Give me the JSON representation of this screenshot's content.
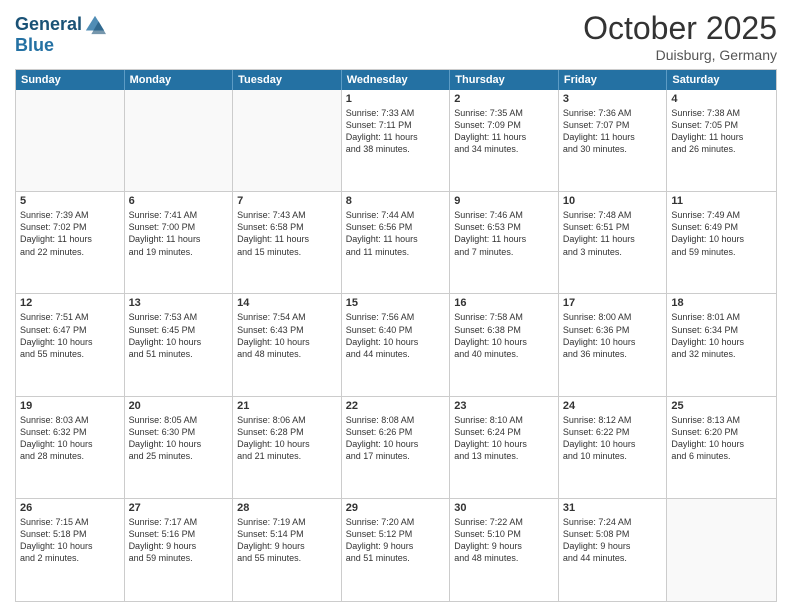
{
  "header": {
    "logo_line1": "General",
    "logo_line2": "Blue",
    "month": "October 2025",
    "location": "Duisburg, Germany"
  },
  "days_of_week": [
    "Sunday",
    "Monday",
    "Tuesday",
    "Wednesday",
    "Thursday",
    "Friday",
    "Saturday"
  ],
  "weeks": [
    [
      {
        "day": "",
        "info": ""
      },
      {
        "day": "",
        "info": ""
      },
      {
        "day": "",
        "info": ""
      },
      {
        "day": "1",
        "info": "Sunrise: 7:33 AM\nSunset: 7:11 PM\nDaylight: 11 hours\nand 38 minutes."
      },
      {
        "day": "2",
        "info": "Sunrise: 7:35 AM\nSunset: 7:09 PM\nDaylight: 11 hours\nand 34 minutes."
      },
      {
        "day": "3",
        "info": "Sunrise: 7:36 AM\nSunset: 7:07 PM\nDaylight: 11 hours\nand 30 minutes."
      },
      {
        "day": "4",
        "info": "Sunrise: 7:38 AM\nSunset: 7:05 PM\nDaylight: 11 hours\nand 26 minutes."
      }
    ],
    [
      {
        "day": "5",
        "info": "Sunrise: 7:39 AM\nSunset: 7:02 PM\nDaylight: 11 hours\nand 22 minutes."
      },
      {
        "day": "6",
        "info": "Sunrise: 7:41 AM\nSunset: 7:00 PM\nDaylight: 11 hours\nand 19 minutes."
      },
      {
        "day": "7",
        "info": "Sunrise: 7:43 AM\nSunset: 6:58 PM\nDaylight: 11 hours\nand 15 minutes."
      },
      {
        "day": "8",
        "info": "Sunrise: 7:44 AM\nSunset: 6:56 PM\nDaylight: 11 hours\nand 11 minutes."
      },
      {
        "day": "9",
        "info": "Sunrise: 7:46 AM\nSunset: 6:53 PM\nDaylight: 11 hours\nand 7 minutes."
      },
      {
        "day": "10",
        "info": "Sunrise: 7:48 AM\nSunset: 6:51 PM\nDaylight: 11 hours\nand 3 minutes."
      },
      {
        "day": "11",
        "info": "Sunrise: 7:49 AM\nSunset: 6:49 PM\nDaylight: 10 hours\nand 59 minutes."
      }
    ],
    [
      {
        "day": "12",
        "info": "Sunrise: 7:51 AM\nSunset: 6:47 PM\nDaylight: 10 hours\nand 55 minutes."
      },
      {
        "day": "13",
        "info": "Sunrise: 7:53 AM\nSunset: 6:45 PM\nDaylight: 10 hours\nand 51 minutes."
      },
      {
        "day": "14",
        "info": "Sunrise: 7:54 AM\nSunset: 6:43 PM\nDaylight: 10 hours\nand 48 minutes."
      },
      {
        "day": "15",
        "info": "Sunrise: 7:56 AM\nSunset: 6:40 PM\nDaylight: 10 hours\nand 44 minutes."
      },
      {
        "day": "16",
        "info": "Sunrise: 7:58 AM\nSunset: 6:38 PM\nDaylight: 10 hours\nand 40 minutes."
      },
      {
        "day": "17",
        "info": "Sunrise: 8:00 AM\nSunset: 6:36 PM\nDaylight: 10 hours\nand 36 minutes."
      },
      {
        "day": "18",
        "info": "Sunrise: 8:01 AM\nSunset: 6:34 PM\nDaylight: 10 hours\nand 32 minutes."
      }
    ],
    [
      {
        "day": "19",
        "info": "Sunrise: 8:03 AM\nSunset: 6:32 PM\nDaylight: 10 hours\nand 28 minutes."
      },
      {
        "day": "20",
        "info": "Sunrise: 8:05 AM\nSunset: 6:30 PM\nDaylight: 10 hours\nand 25 minutes."
      },
      {
        "day": "21",
        "info": "Sunrise: 8:06 AM\nSunset: 6:28 PM\nDaylight: 10 hours\nand 21 minutes."
      },
      {
        "day": "22",
        "info": "Sunrise: 8:08 AM\nSunset: 6:26 PM\nDaylight: 10 hours\nand 17 minutes."
      },
      {
        "day": "23",
        "info": "Sunrise: 8:10 AM\nSunset: 6:24 PM\nDaylight: 10 hours\nand 13 minutes."
      },
      {
        "day": "24",
        "info": "Sunrise: 8:12 AM\nSunset: 6:22 PM\nDaylight: 10 hours\nand 10 minutes."
      },
      {
        "day": "25",
        "info": "Sunrise: 8:13 AM\nSunset: 6:20 PM\nDaylight: 10 hours\nand 6 minutes."
      }
    ],
    [
      {
        "day": "26",
        "info": "Sunrise: 7:15 AM\nSunset: 5:18 PM\nDaylight: 10 hours\nand 2 minutes."
      },
      {
        "day": "27",
        "info": "Sunrise: 7:17 AM\nSunset: 5:16 PM\nDaylight: 9 hours\nand 59 minutes."
      },
      {
        "day": "28",
        "info": "Sunrise: 7:19 AM\nSunset: 5:14 PM\nDaylight: 9 hours\nand 55 minutes."
      },
      {
        "day": "29",
        "info": "Sunrise: 7:20 AM\nSunset: 5:12 PM\nDaylight: 9 hours\nand 51 minutes."
      },
      {
        "day": "30",
        "info": "Sunrise: 7:22 AM\nSunset: 5:10 PM\nDaylight: 9 hours\nand 48 minutes."
      },
      {
        "day": "31",
        "info": "Sunrise: 7:24 AM\nSunset: 5:08 PM\nDaylight: 9 hours\nand 44 minutes."
      },
      {
        "day": "",
        "info": ""
      }
    ]
  ]
}
